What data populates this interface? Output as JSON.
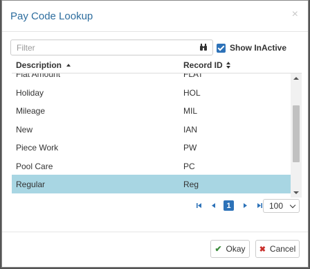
{
  "dialog": {
    "title": "Pay Code Lookup",
    "close_glyph": "×"
  },
  "filter": {
    "placeholder": "Filter",
    "value": ""
  },
  "show_inactive": {
    "label": "Show InActive",
    "checked": true
  },
  "columns": [
    {
      "label": "Description",
      "sort": "ascending"
    },
    {
      "label": "Record ID",
      "sort": "none"
    }
  ],
  "rows": [
    {
      "description": "Flat Amount",
      "record_id": "FLAT",
      "selected": false
    },
    {
      "description": "Holiday",
      "record_id": "HOL",
      "selected": false
    },
    {
      "description": "Mileage",
      "record_id": "MIL",
      "selected": false
    },
    {
      "description": "New",
      "record_id": "IAN",
      "selected": false
    },
    {
      "description": "Piece Work",
      "record_id": "PW",
      "selected": false
    },
    {
      "description": "Pool Care",
      "record_id": "PC",
      "selected": false
    },
    {
      "description": "Regular",
      "record_id": "Reg",
      "selected": true
    }
  ],
  "pager": {
    "current_page": "1",
    "page_size": "100"
  },
  "buttons": {
    "ok": "Okay",
    "cancel": "Cancel"
  },
  "colors": {
    "accent": "#2d72b8",
    "selected_row": "#a8d6e3",
    "title": "#2d6d9e"
  },
  "icons": [
    "close-icon",
    "binoculars-icon",
    "checkbox-checked-icon",
    "sort-asc-icon",
    "sort-both-icon",
    "first-page-icon",
    "prev-page-icon",
    "next-page-icon",
    "last-page-icon",
    "chevron-down-icon",
    "check-icon",
    "times-icon"
  ]
}
